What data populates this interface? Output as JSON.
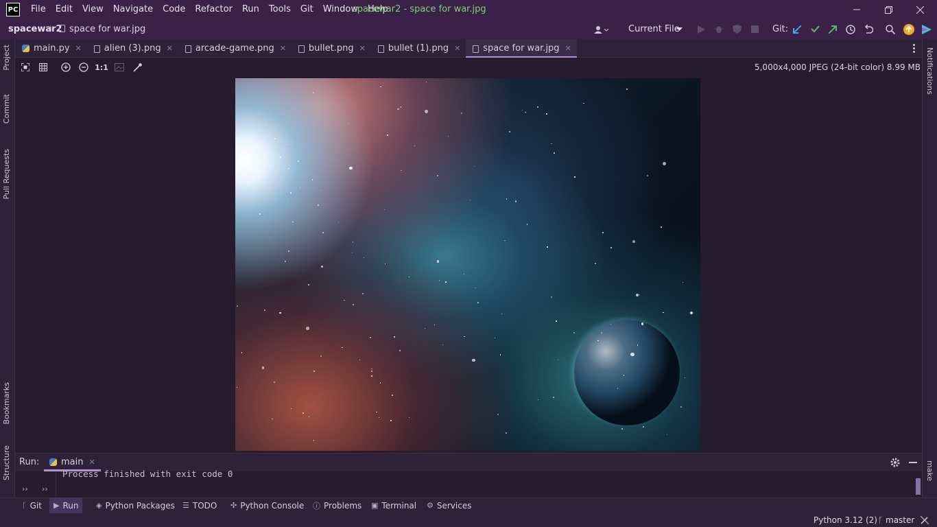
{
  "title_bar": {
    "logo": "PC",
    "window_title": "spacewar2 - space for war.jpg",
    "menu": [
      {
        "label": "File"
      },
      {
        "label": "Edit"
      },
      {
        "label": "View"
      },
      {
        "label": "Navigate"
      },
      {
        "label": "Code"
      },
      {
        "label": "Refactor"
      },
      {
        "label": "Run"
      },
      {
        "label": "Tools"
      },
      {
        "label": "Git"
      },
      {
        "label": "Window"
      },
      {
        "label": "Help"
      }
    ]
  },
  "nav_bar": {
    "project": "spacewar2",
    "file": "space for war.jpg",
    "run_config": "Current File",
    "git_label": "Git:"
  },
  "tabs": [
    {
      "label": "main.py",
      "active": false
    },
    {
      "label": "alien (3).png",
      "active": false
    },
    {
      "label": "arcade-game.png",
      "active": false
    },
    {
      "label": "bullet.png",
      "active": false
    },
    {
      "label": "bullet (1).png",
      "active": false
    },
    {
      "label": "space for war.jpg",
      "active": true
    }
  ],
  "left_tools": [
    "Project",
    "Commit",
    "Pull Requests",
    "Bookmarks",
    "Structure"
  ],
  "right_tools": [
    "Notifications",
    "make"
  ],
  "image_viewer": {
    "zoom_label": "1:1",
    "info": "5,000x4,000 JPEG (24-bit color) 8.99 MB"
  },
  "run_panel": {
    "label": "Run:",
    "tab": "main",
    "output": "Process finished with exit code 0"
  },
  "tool_windows": [
    {
      "label": "Git",
      "icon": "git-branch-icon"
    },
    {
      "label": "Run",
      "icon": "play-icon",
      "active": true
    },
    {
      "label": "Python Packages",
      "icon": "layers-icon"
    },
    {
      "label": "TODO",
      "icon": "list-icon"
    },
    {
      "label": "Python Console",
      "icon": "python-icon"
    },
    {
      "label": "Problems",
      "icon": "info-icon"
    },
    {
      "label": "Terminal",
      "icon": "terminal-icon"
    },
    {
      "label": "Services",
      "icon": "services-icon"
    }
  ],
  "status_bar": {
    "interpreter": "Python 3.12 (2)",
    "branch": "master"
  },
  "colors": {
    "accent": "#b78fd6",
    "window_title": "#7fd07a",
    "titlebar": "#3b2148",
    "background": "#261c2e"
  }
}
